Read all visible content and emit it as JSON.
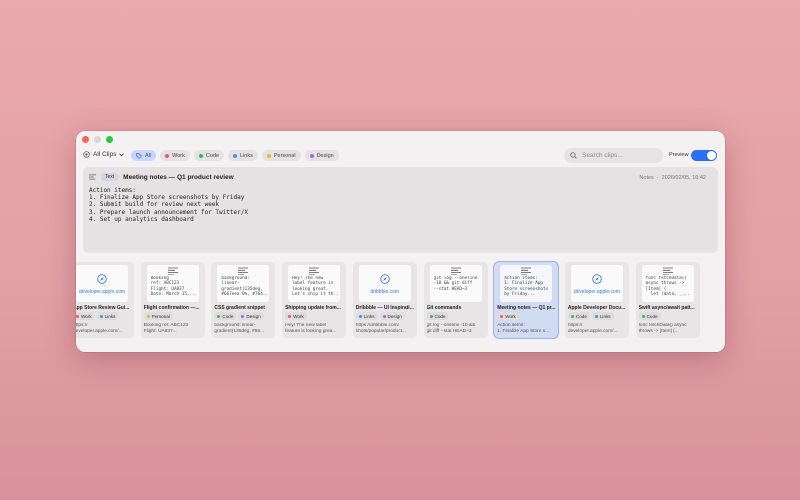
{
  "toolbar": {
    "all_clips_label": "All Clips",
    "filters": [
      {
        "label": "All",
        "color": "#4a6fd1",
        "active": true
      },
      {
        "label": "Work",
        "color": "#e85a5a"
      },
      {
        "label": "Code",
        "color": "#3cb55e"
      },
      {
        "label": "Links",
        "color": "#4a90e2"
      },
      {
        "label": "Personal",
        "color": "#e2b93b"
      },
      {
        "label": "Design",
        "color": "#a06ad6"
      }
    ],
    "search_placeholder": "Search clips...",
    "preview_label": "Preview",
    "preview_enabled": true
  },
  "preview": {
    "type_badge": "Text",
    "title": "Meeting notes — Q1 product review",
    "category": "Notes",
    "timestamp": "2026/02/05, 16:42",
    "body": "Action items:\n1. Finalize App Store screenshots by Friday\n2. Submit build for review next week\n3. Prepare launch announcement for Twitter/X\n4. Set up analytics dashboard"
  },
  "cards": [
    {
      "kind": "link",
      "thumb_domain": "developer.apple.com",
      "title": "App Store Review Gui...",
      "tags": [
        {
          "label": "Work",
          "color": "#e85a5a"
        },
        {
          "label": "Links",
          "color": "#4a90e2"
        }
      ],
      "snippet": "https://\ndeveloper.apple.com/..."
    },
    {
      "kind": "text",
      "thumb_text": "Booking\nref: ABC123\nFlight: UA837\nDate: March 15,...",
      "title": "Flight confirmation —...",
      "tags": [
        {
          "label": "Personal",
          "color": "#e2b93b"
        }
      ],
      "snippet": "Booking ref: ABC123\nFlight: UA837..."
    },
    {
      "kind": "text",
      "thumb_text": "background:\nlinear-\ngradient(135deg,\n#667eea 0%, #764...",
      "title": "CSS gradient snippet",
      "tags": [
        {
          "label": "Code",
          "color": "#3cb55e"
        },
        {
          "label": "Design",
          "color": "#a06ad6"
        }
      ],
      "snippet": "background: linear-\ngradient(135deg, #66..."
    },
    {
      "kind": "text",
      "thumb_text": "Hey! The new\nlabel feature is\nlooking great.\nLet's ship it th...",
      "title": "Shipping update from...",
      "tags": [
        {
          "label": "Work",
          "color": "#e85a5a"
        }
      ],
      "snippet": "Hey! The new label\nfeature is looking grea..."
    },
    {
      "kind": "link",
      "thumb_domain": "dribbble.com",
      "title": "Dribbble — UI Inspirati...",
      "tags": [
        {
          "label": "Links",
          "color": "#4a90e2"
        },
        {
          "label": "Design",
          "color": "#a06ad6"
        }
      ],
      "snippet": "https://dribbble.com/\nshots/popular/product..."
    },
    {
      "kind": "text",
      "thumb_text": "git log --oneline\n-10 && git diff\n--stat HEAD~3",
      "title": "Git commands",
      "tags": [
        {
          "label": "Code",
          "color": "#3cb55e"
        }
      ],
      "snippet": "git log --oneline -10 &&\ngit diff --stat HEAD~3"
    },
    {
      "kind": "text",
      "selected": true,
      "thumb_text": "Action items:\n1. Finalize App\nStore screenshots\nby Friday...",
      "title": "Meeting notes — Q1 pr...",
      "tags": [
        {
          "label": "Work",
          "color": "#e85a5a"
        }
      ],
      "snippet": "Action items:\n1. Finalize App Store s..."
    },
    {
      "kind": "link",
      "thumb_domain": "developer.apple.com",
      "title": "Apple Developer Docu...",
      "tags": [
        {
          "label": "Code",
          "color": "#3cb55e"
        },
        {
          "label": "Links",
          "color": "#4a90e2"
        }
      ],
      "snippet": "https://\ndeveloper.apple.com/..."
    },
    {
      "kind": "text",
      "thumb_text": "func fetchData()\nasync throws ->\n[Item] {\n  let (data, _...",
      "title": "Swift async/await patt...",
      "tags": [
        {
          "label": "Code",
          "color": "#3cb55e"
        }
      ],
      "snippet": "func fetchData() async\nthrows -> [Item] {..."
    }
  ]
}
